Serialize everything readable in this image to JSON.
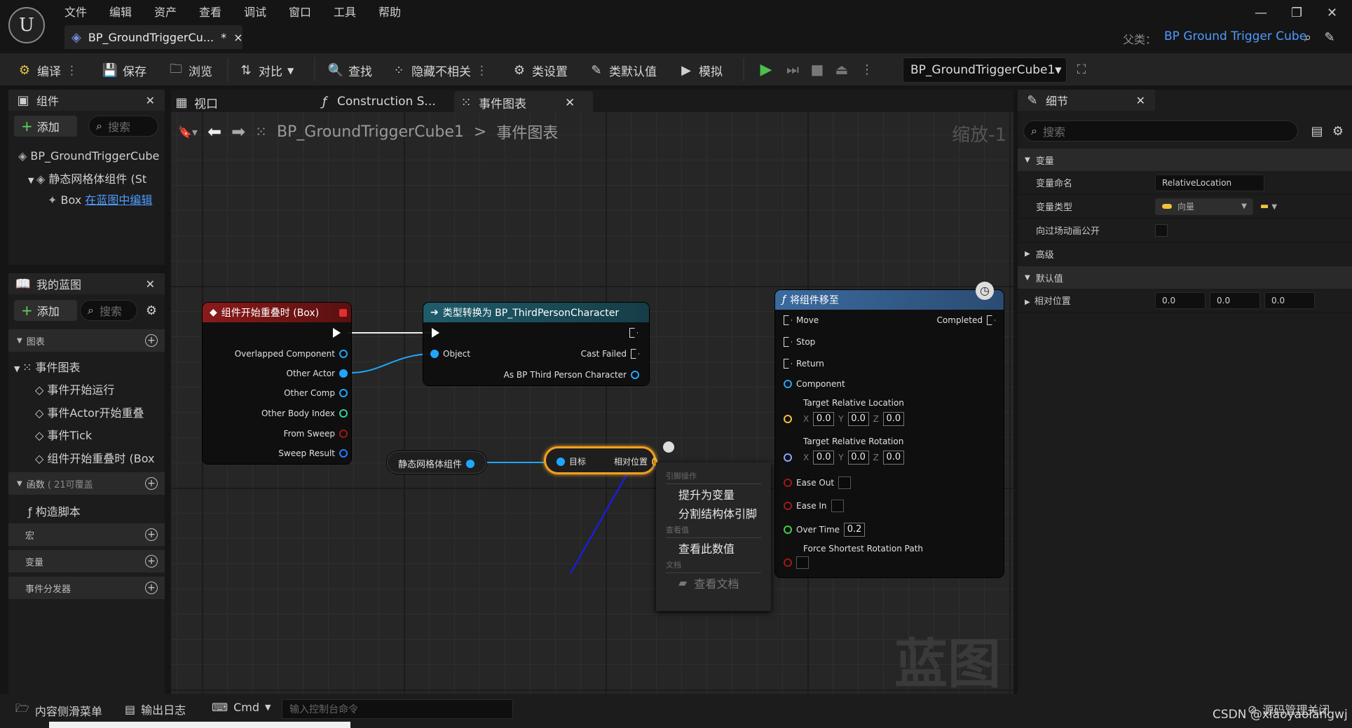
{
  "menu": [
    "文件",
    "编辑",
    "资产",
    "查看",
    "调试",
    "窗口",
    "工具",
    "帮助"
  ],
  "doc_tab": {
    "title": "BP_GroundTriggerCu...",
    "modified": "*",
    "close": "×"
  },
  "window_controls": {
    "minimize": "—",
    "restore": "❐",
    "close": "✕"
  },
  "parent": {
    "label": "父类：",
    "value": "BP Ground Trigger Cube"
  },
  "toolbar": {
    "compile": "编译",
    "save": "保存",
    "browse": "浏览",
    "diff": "对比",
    "find": "查找",
    "hide_unrelated": "隐藏不相关",
    "class_settings": "类设置",
    "class_defaults": "类默认值",
    "simulate": "模拟",
    "debug_object": "BP_GroundTriggerCube1"
  },
  "components_panel": {
    "title": "组件",
    "add": "添加",
    "search_placeholder": "搜索",
    "root": "BP_GroundTriggerCube",
    "child": "静态网格体组件 (St",
    "grandchild": "Box",
    "edit_link": "在蓝图中编辑"
  },
  "tabs": {
    "viewport": "视口",
    "construction": "Construction S...",
    "event_graph": "事件图表"
  },
  "breadcrumb": {
    "blueprint": "BP_GroundTriggerCube1",
    "separator": ">",
    "graph": "事件图表"
  },
  "zoom": "缩放-1",
  "watermark": "蓝图",
  "my_blueprint": {
    "title": "我的蓝图",
    "add": "添加",
    "search_placeholder": "搜索",
    "graphs_label": "图表",
    "event_graph": "事件图表",
    "events": [
      "事件开始运行",
      "事件Actor开始重叠",
      "事件Tick",
      "组件开始重叠时 (Box"
    ],
    "functions_label": "函数",
    "functions_count": "( 21可覆盖",
    "construction_script": "构造脚本",
    "macros_label": "宏",
    "variables_label": "变量",
    "dispatchers_label": "事件分发器"
  },
  "nodes": {
    "overlap": {
      "title": "组件开始重叠时 (Box)",
      "pins": [
        "Overlapped Component",
        "Other Actor",
        "Other Comp",
        "Other Body Index",
        "From Sweep",
        "Sweep Result"
      ]
    },
    "cast": {
      "title": "类型转换为 BP_ThirdPersonCharacter",
      "object": "Object",
      "cast_failed": "Cast Failed",
      "as_character": "As BP Third Person Character"
    },
    "mesh_var": {
      "label": "静态网格体组件"
    },
    "get_rel": {
      "target": "目标",
      "rel_loc": "相对位置"
    },
    "move": {
      "title": "将组件移至",
      "move": "Move",
      "completed": "Completed",
      "stop": "Stop",
      "return": "Return",
      "component": "Component",
      "target_loc": "Target Relative Location",
      "target_rot": "Target Relative Rotation",
      "x": "X",
      "y": "Y",
      "z": "Z",
      "vec_val": "0.0",
      "ease_out": "Ease Out",
      "ease_in": "Ease In",
      "over_time": "Over Time",
      "over_time_val": "0.2",
      "force_shortest": "Force Shortest Rotation Path"
    }
  },
  "context_menu": {
    "section_ref": "引脚操作",
    "promote": "提升为变量",
    "split": "分割结构体引脚",
    "section_watch": "查看值",
    "watch": "查看此数值",
    "section_docs": "文档",
    "docs": "查看文档"
  },
  "details": {
    "title": "细节",
    "search_placeholder": "搜索",
    "variable_cat": "变量",
    "var_name_label": "变量命名",
    "var_name": "RelativeLocation",
    "var_type_label": "变量类型",
    "var_type": "向量",
    "expose_label": "向过场动画公开",
    "advanced_cat": "高级",
    "defaults_cat": "默认值",
    "rel_loc_label": "相对位置",
    "rel_loc_values": [
      "0.0",
      "0.0",
      "0.0"
    ]
  },
  "statusbar": {
    "content_drawer": "内容侧滑菜单",
    "output_log": "输出日志",
    "cmd": "Cmd",
    "console_placeholder": "输入控制台命令",
    "source_control": "源码管理关闭"
  },
  "credit": "CSDN @xiaoyaolangwj",
  "colors": {
    "accent_blue": "#4f9bff",
    "event_red": "#8b1a1a",
    "cast_teal": "#1f5c6b",
    "func_blue": "#3b6a9e",
    "object_pin": "#1fa7ff",
    "vector_pin": "#f5c13b",
    "bool_pin": "#a01818",
    "float_pin": "#40d040",
    "play_green": "#4cc04c"
  }
}
